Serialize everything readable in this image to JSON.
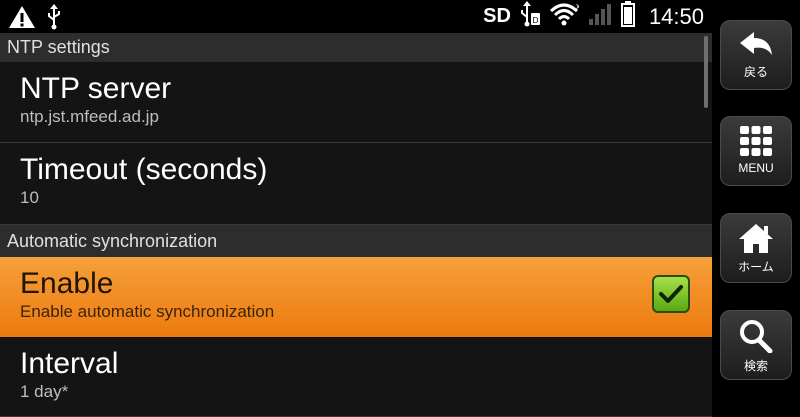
{
  "status_bar": {
    "sd_label": "SD",
    "time": "14:50"
  },
  "sections": [
    {
      "header": "NTP settings",
      "items": [
        {
          "title": "NTP server",
          "summary": "ntp.jst.mfeed.ad.jp"
        },
        {
          "title": "Timeout (seconds)",
          "summary": "10"
        }
      ]
    },
    {
      "header": "Automatic synchronization",
      "items": [
        {
          "title": "Enable",
          "summary": "Enable automatic synchronization",
          "checked": true
        },
        {
          "title": "Interval",
          "summary": "1 day*"
        }
      ]
    }
  ],
  "nav": {
    "back_label": "戻る",
    "menu_label": "MENU",
    "home_label": "ホーム",
    "search_label": "検索"
  },
  "colors": {
    "selected_start": "#f6a03a",
    "selected_end": "#ec7a0e",
    "checkbox_green": "#7cc52b"
  }
}
